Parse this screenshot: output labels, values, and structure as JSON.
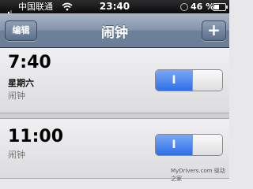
{
  "status_bar": {
    "carrier": "中国联通",
    "time": "23:40",
    "battery_percent": "46 %",
    "battery_level": 0.46,
    "signal_bars": 3
  },
  "nav": {
    "edit_label": "编辑",
    "title": "闹钟",
    "add_label": "+"
  },
  "alarms": [
    {
      "time": "7:40",
      "repeat": "星期六",
      "label": "闹钟",
      "enabled": true,
      "toggle_text": "I"
    },
    {
      "time": "11:00",
      "label": "闹钟",
      "enabled": true,
      "toggle_text": "I"
    }
  ],
  "watermark": "MyDrivers.com 驱动之家",
  "colors": {
    "navbar": "#7b8da5",
    "toggle_on": "#2f6fe6",
    "background": "#e8e8ea"
  }
}
